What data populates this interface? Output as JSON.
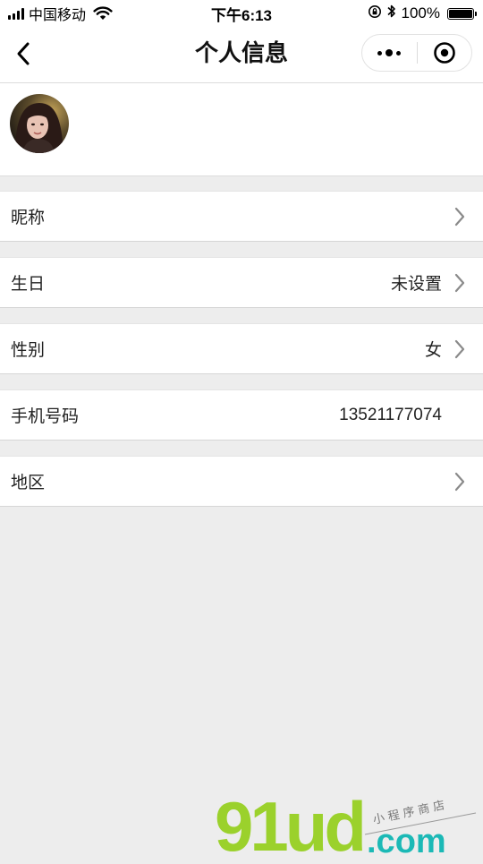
{
  "status_bar": {
    "carrier": "中国移动",
    "time": "下午6:13",
    "battery_text": "100%",
    "battery_level": 1.0,
    "icons": [
      "signal-icon",
      "wifi-icon",
      "orientation-lock-icon",
      "bluetooth-icon",
      "battery-icon"
    ]
  },
  "nav": {
    "title": "个人信息",
    "back_icon": "chevron-left-icon",
    "more_icon": "more-dots-icon",
    "close_icon": "target-close-icon"
  },
  "profile": {
    "avatar_icon": "user-avatar"
  },
  "rows": [
    {
      "label": "昵称",
      "value": "",
      "chevron": true
    },
    {
      "label": "生日",
      "value": "未设置",
      "chevron": true
    },
    {
      "label": "性别",
      "value": "女",
      "chevron": true
    },
    {
      "label": "手机号码",
      "value": "13521177074",
      "chevron": false
    },
    {
      "label": "地区",
      "value": "",
      "chevron": true
    }
  ],
  "watermark": {
    "logo": "91ud",
    "domain": ".com",
    "tagline": "小 程 序 商 店",
    "colors": {
      "green": "#9bd12c",
      "teal": "#1bb9b6"
    }
  }
}
